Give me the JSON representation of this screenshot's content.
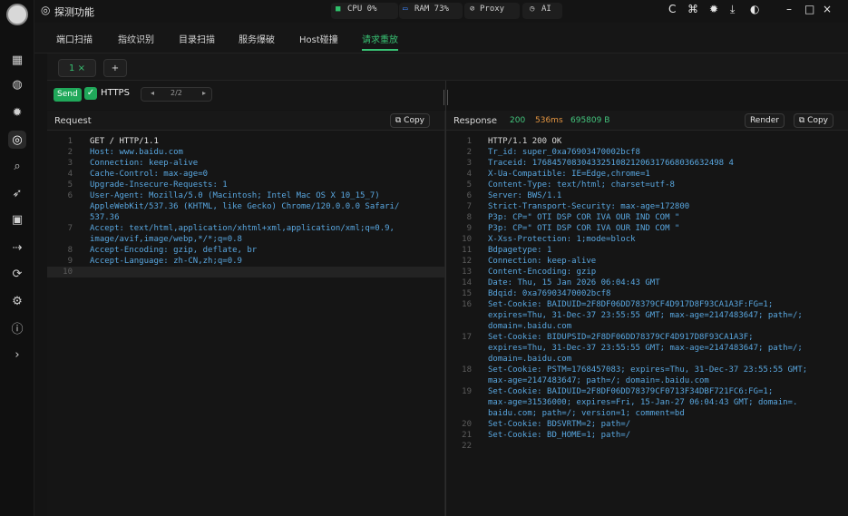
{
  "window": {
    "title": "探测功能"
  },
  "system": {
    "cpu": "CPU 0%",
    "ram": "RAM 73%",
    "proxy": "Proxy",
    "ai": "AI"
  },
  "tabs": [
    {
      "label": "端口扫描"
    },
    {
      "label": "指纹识别"
    },
    {
      "label": "目录扫描"
    },
    {
      "label": "服务爆破"
    },
    {
      "label": "Host碰撞"
    },
    {
      "label": "请求重放"
    }
  ],
  "session": {
    "tab_label": "1 ×",
    "add_label": "+"
  },
  "controls": {
    "send_label": "Send",
    "https_label": "HTTPS",
    "page_label": "2/2"
  },
  "request": {
    "title": "Request",
    "copy_label": "Copy",
    "lines": [
      {
        "n": "1",
        "text": "GET / HTTP/1.1"
      },
      {
        "n": "2",
        "text": "Host: www.baidu.com"
      },
      {
        "n": "3",
        "text": "Connection: keep-alive"
      },
      {
        "n": "4",
        "text": "Cache-Control: max-age=0"
      },
      {
        "n": "5",
        "text": "Upgrade-Insecure-Requests: 1"
      },
      {
        "n": "6",
        "text": "User-Agent: Mozilla/5.0 (Macintosh; Intel Mac OS X 10_15_7)"
      },
      {
        "n": "",
        "text": "AppleWebKit/537.36 (KHTML, like Gecko) Chrome/120.0.0.0 Safari/"
      },
      {
        "n": "",
        "text": "537.36"
      },
      {
        "n": "7",
        "text": "Accept: text/html,application/xhtml+xml,application/xml;q=0.9,"
      },
      {
        "n": "",
        "text": "image/avif,image/webp,*/*;q=0.8"
      },
      {
        "n": "8",
        "text": "Accept-Encoding: gzip, deflate, br"
      },
      {
        "n": "9",
        "text": "Accept-Language: zh-CN,zh;q=0.9"
      },
      {
        "n": "10",
        "text": ""
      }
    ]
  },
  "response": {
    "title": "Response",
    "status": "200",
    "time": "536ms",
    "size": "695809 B",
    "render_label": "Render",
    "copy_label": "Copy",
    "lines": [
      {
        "n": "1",
        "text": "HTTP/1.1 200 OK"
      },
      {
        "n": "2",
        "text": "Tr_id: super_0xa76903470002bcf8"
      },
      {
        "n": "3",
        "text": "Traceid: 176845708304332510821206317668036632498 4"
      },
      {
        "n": "4",
        "text": "X-Ua-Compatible: IE=Edge,chrome=1"
      },
      {
        "n": "5",
        "text": "Content-Type: text/html; charset=utf-8"
      },
      {
        "n": "6",
        "text": "Server: BWS/1.1"
      },
      {
        "n": "7",
        "text": "Strict-Transport-Security: max-age=172800"
      },
      {
        "n": "8",
        "text": "P3p: CP=\" OTI DSP COR IVA OUR IND COM \""
      },
      {
        "n": "9",
        "text": "P3p: CP=\" OTI DSP COR IVA OUR IND COM \""
      },
      {
        "n": "10",
        "text": "X-Xss-Protection: 1;mode=block"
      },
      {
        "n": "11",
        "text": "Bdpagetype: 1"
      },
      {
        "n": "12",
        "text": "Connection: keep-alive"
      },
      {
        "n": "13",
        "text": "Content-Encoding: gzip"
      },
      {
        "n": "14",
        "text": "Date: Thu, 15 Jan 2026 06:04:43 GMT"
      },
      {
        "n": "15",
        "text": "Bdqid: 0xa76903470002bcf8"
      },
      {
        "n": "16",
        "text": "Set-Cookie: BAIDUID=2F8DF06DD78379CF4D917D8F93CA1A3F:FG=1;"
      },
      {
        "n": "",
        "text": "expires=Thu, 31-Dec-37 23:55:55 GMT; max-age=2147483647; path=/;"
      },
      {
        "n": "",
        "text": "domain=.baidu.com"
      },
      {
        "n": "17",
        "text": "Set-Cookie: BIDUPSID=2F8DF06DD78379CF4D917D8F93CA1A3F;"
      },
      {
        "n": "",
        "text": "expires=Thu, 31-Dec-37 23:55:55 GMT; max-age=2147483647; path=/;"
      },
      {
        "n": "",
        "text": "domain=.baidu.com"
      },
      {
        "n": "18",
        "text": "Set-Cookie: PSTM=1768457083; expires=Thu, 31-Dec-37 23:55:55 GMT;"
      },
      {
        "n": "",
        "text": "max-age=2147483647; path=/; domain=.baidu.com"
      },
      {
        "n": "19",
        "text": "Set-Cookie: BAIDUID=2F8DF06DD78379CF0713F34DBF721FC6:FG=1;"
      },
      {
        "n": "",
        "text": "max-age=31536000; expires=Fri, 15-Jan-27 06:04:43 GMT; domain=."
      },
      {
        "n": "",
        "text": "baidu.com; path=/; version=1; comment=bd"
      },
      {
        "n": "20",
        "text": "Set-Cookie: BDSVRTM=2; path=/"
      },
      {
        "n": "21",
        "text": "Set-Cookie: BD_HOME=1; path=/"
      },
      {
        "n": "22",
        "text": ""
      }
    ]
  }
}
